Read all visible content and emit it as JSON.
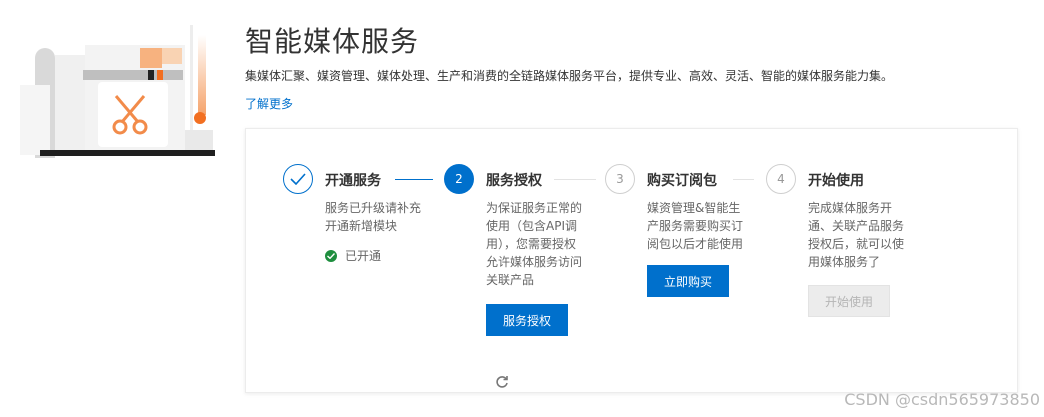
{
  "header": {
    "title": "智能媒体服务",
    "description": "集媒体汇聚、媒资管理、媒体处理、生产和消费的全链路媒体服务平台，提供专业、高效、灵活、智能的媒体服务能力集。",
    "learn_more": "了解更多"
  },
  "steps": [
    {
      "number": "",
      "title": "开通服务",
      "description": "服务已升级请补充\n开通新增模块",
      "status": "已开通",
      "state": "done"
    },
    {
      "number": "2",
      "title": "服务授权",
      "description": "为保证服务正常的\n使用（包含API调\n用），您需要授权\n允许媒体服务访问\n关联产品",
      "button": "服务授权",
      "state": "active"
    },
    {
      "number": "3",
      "title": "购买订阅包",
      "description": "媒资管理&智能生\n产服务需要购买订\n阅包以后才能使用",
      "button": "立即购买",
      "state": "pending"
    },
    {
      "number": "4",
      "title": "开始使用",
      "description": "完成媒体服务开\n通、关联产品服务\n授权后，就可以使\n用媒体服务了",
      "button": "开始使用",
      "state": "disabled"
    }
  ],
  "icons": {
    "step1": "check-icon",
    "status": "check-circle-icon",
    "refresh": "refresh-icon",
    "illustration": "scissors-icon"
  },
  "colors": {
    "primary": "#0070cc",
    "success": "#1e8e3e",
    "accent": "#f26f21",
    "muted": "#999999"
  },
  "watermark": "CSDN @csdn565973850"
}
